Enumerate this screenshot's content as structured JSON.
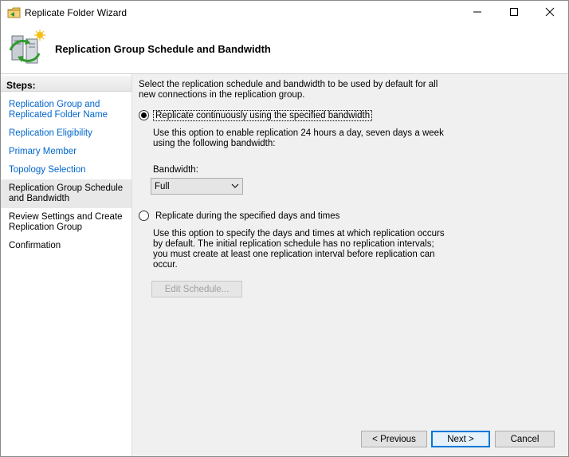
{
  "window": {
    "title": "Replicate Folder Wizard",
    "controls": {
      "minimize": "minimize-icon",
      "maximize": "maximize-icon",
      "close": "close-icon"
    }
  },
  "header": {
    "title": "Replication Group Schedule and Bandwidth",
    "icon": "replication-servers-icon"
  },
  "steps": {
    "heading": "Steps:",
    "items": [
      {
        "label": "Replication Group and Replicated Folder Name",
        "state": "link"
      },
      {
        "label": "Replication Eligibility",
        "state": "link"
      },
      {
        "label": "Primary Member",
        "state": "link"
      },
      {
        "label": "Topology Selection",
        "state": "link"
      },
      {
        "label": "Replication Group Schedule and Bandwidth",
        "state": "current"
      },
      {
        "label": "Review Settings and Create Replication Group",
        "state": "plain"
      },
      {
        "label": "Confirmation",
        "state": "plain"
      }
    ]
  },
  "main": {
    "intro": "Select the replication schedule and bandwidth to be used by default for all new connections in the replication group.",
    "option_continuous": {
      "label": "Replicate continuously using the specified bandwidth",
      "selected": true,
      "description": "Use this option to enable replication 24 hours a day, seven days a week using the following bandwidth:"
    },
    "bandwidth": {
      "label": "Bandwidth:",
      "value": "Full"
    },
    "option_schedule": {
      "label": "Replicate during the specified days and times",
      "selected": false,
      "description": "Use this option to specify the days and times at which replication occurs by default. The initial replication schedule has no replication intervals; you must create at least one replication interval before replication can occur."
    },
    "edit_schedule_label": "Edit Schedule..."
  },
  "footer": {
    "previous_label": "< Previous",
    "next_label": "Next >",
    "cancel_label": "Cancel"
  },
  "colors": {
    "link": "#0066cc",
    "content_bg": "#f0f0f0",
    "current_step_bg": "#e8e8e8",
    "default_button_border": "#0078d7"
  }
}
